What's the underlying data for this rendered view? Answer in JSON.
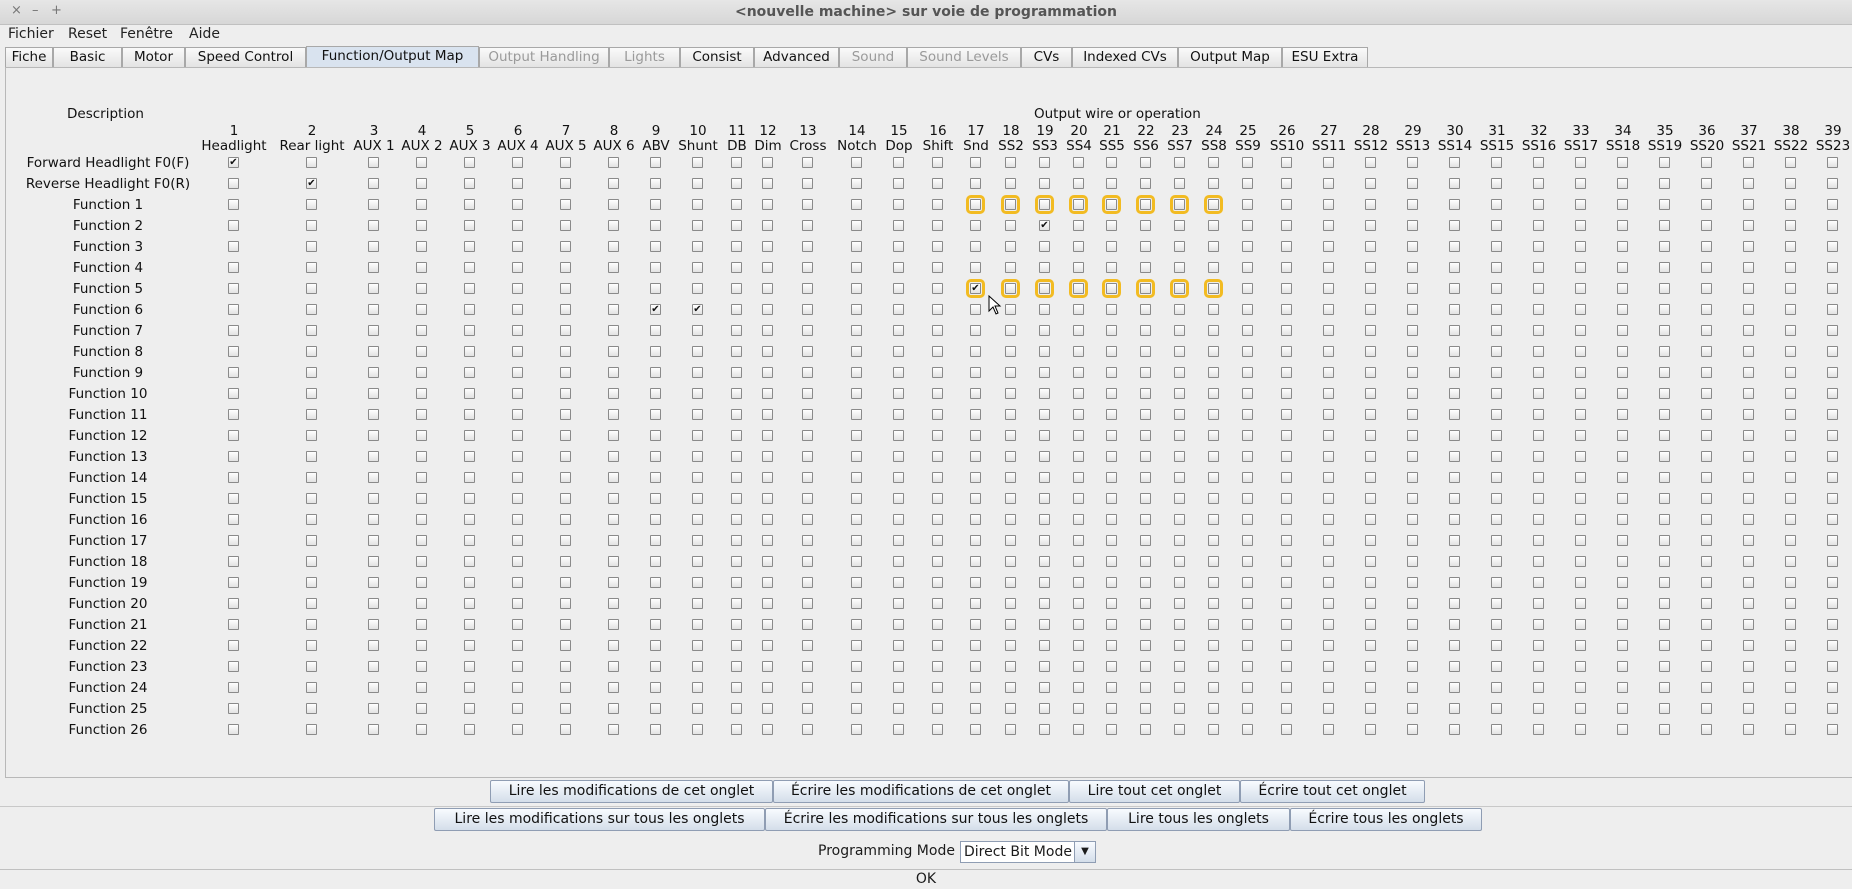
{
  "window": {
    "title": "<nouvelle machine> sur voie de programmation",
    "controls": [
      "×",
      "–",
      "+"
    ]
  },
  "menubar": [
    "Fichier",
    "Reset",
    "Fenêtre",
    "Aide"
  ],
  "tabs": [
    {
      "label": "Fiche",
      "enabled": true
    },
    {
      "label": "Basic",
      "enabled": true
    },
    {
      "label": "Motor",
      "enabled": true
    },
    {
      "label": "Speed Control",
      "enabled": true
    },
    {
      "label": "Function/Output Map",
      "enabled": true,
      "selected": true
    },
    {
      "label": "Output Handling",
      "enabled": false
    },
    {
      "label": "Lights",
      "enabled": false
    },
    {
      "label": "Consist",
      "enabled": true
    },
    {
      "label": "Advanced",
      "enabled": true
    },
    {
      "label": "Sound",
      "enabled": false
    },
    {
      "label": "Sound Levels",
      "enabled": false
    },
    {
      "label": "CVs",
      "enabled": true
    },
    {
      "label": "Indexed CVs",
      "enabled": true
    },
    {
      "label": "Output Map",
      "enabled": true
    },
    {
      "label": "ESU Extra",
      "enabled": true
    }
  ],
  "grid": {
    "description_header": "Description",
    "output_header": "Output wire or operation",
    "columns": [
      {
        "num": "1",
        "name": "Headlight"
      },
      {
        "num": "2",
        "name": "Rear light"
      },
      {
        "num": "3",
        "name": "AUX 1"
      },
      {
        "num": "4",
        "name": "AUX 2"
      },
      {
        "num": "5",
        "name": "AUX 3"
      },
      {
        "num": "6",
        "name": "AUX 4"
      },
      {
        "num": "7",
        "name": "AUX 5"
      },
      {
        "num": "8",
        "name": "AUX 6"
      },
      {
        "num": "9",
        "name": "ABV"
      },
      {
        "num": "10",
        "name": "Shunt"
      },
      {
        "num": "11",
        "name": "DB"
      },
      {
        "num": "12",
        "name": "Dim"
      },
      {
        "num": "13",
        "name": "Cross"
      },
      {
        "num": "14",
        "name": "Notch"
      },
      {
        "num": "15",
        "name": "Dop"
      },
      {
        "num": "16",
        "name": "Shift"
      },
      {
        "num": "17",
        "name": "Snd"
      },
      {
        "num": "18",
        "name": "SS2"
      },
      {
        "num": "19",
        "name": "SS3"
      },
      {
        "num": "20",
        "name": "SS4"
      },
      {
        "num": "21",
        "name": "SS5"
      },
      {
        "num": "22",
        "name": "SS6"
      },
      {
        "num": "23",
        "name": "SS7"
      },
      {
        "num": "24",
        "name": "SS8"
      },
      {
        "num": "25",
        "name": "SS9"
      },
      {
        "num": "26",
        "name": "SS10"
      },
      {
        "num": "27",
        "name": "SS11"
      },
      {
        "num": "28",
        "name": "SS12"
      },
      {
        "num": "29",
        "name": "SS13"
      },
      {
        "num": "30",
        "name": "SS14"
      },
      {
        "num": "31",
        "name": "SS15"
      },
      {
        "num": "32",
        "name": "SS16"
      },
      {
        "num": "33",
        "name": "SS17"
      },
      {
        "num": "34",
        "name": "SS18"
      },
      {
        "num": "35",
        "name": "SS19"
      },
      {
        "num": "36",
        "name": "SS20"
      },
      {
        "num": "37",
        "name": "SS21"
      },
      {
        "num": "38",
        "name": "SS22"
      },
      {
        "num": "39",
        "name": "SS23"
      }
    ],
    "rows": [
      "Forward Headlight F0(F)",
      "Reverse Headlight F0(R)",
      "Function 1",
      "Function 2",
      "Function 3",
      "Function 4",
      "Function 5",
      "Function 6",
      "Function 7",
      "Function 8",
      "Function 9",
      "Function 10",
      "Function 11",
      "Function 12",
      "Function 13",
      "Function 14",
      "Function 15",
      "Function 16",
      "Function 17",
      "Function 18",
      "Function 19",
      "Function 20",
      "Function 21",
      "Function 22",
      "Function 23",
      "Function 24",
      "Function 25",
      "Function 26"
    ],
    "checked": [
      [
        0,
        0
      ],
      [
        1,
        1
      ],
      [
        3,
        18
      ],
      [
        6,
        16
      ],
      [
        7,
        8
      ],
      [
        7,
        9
      ]
    ],
    "highlighted": [
      [
        2,
        16
      ],
      [
        2,
        17
      ],
      [
        2,
        18
      ],
      [
        2,
        19
      ],
      [
        2,
        20
      ],
      [
        2,
        21
      ],
      [
        2,
        22
      ],
      [
        2,
        23
      ],
      [
        6,
        16
      ],
      [
        6,
        17
      ],
      [
        6,
        18
      ],
      [
        6,
        19
      ],
      [
        6,
        20
      ],
      [
        6,
        21
      ],
      [
        6,
        22
      ],
      [
        6,
        23
      ]
    ],
    "highlight_color": "#f2bb22",
    "check_glyph": "✔"
  },
  "buttons_tab": [
    "Lire les modifications de cet onglet",
    "Écrire les modifications de cet onglet",
    "Lire tout cet onglet",
    "Écrire tout cet onglet"
  ],
  "buttons_all": [
    "Lire les modifications sur tous les onglets",
    "Écrire les modifications sur tous les onglets",
    "Lire tous les onglets",
    "Écrire tous les onglets"
  ],
  "programming": {
    "label": "Programming Mode",
    "mode": "Direct Bit Mode"
  },
  "ok_label": "OK"
}
